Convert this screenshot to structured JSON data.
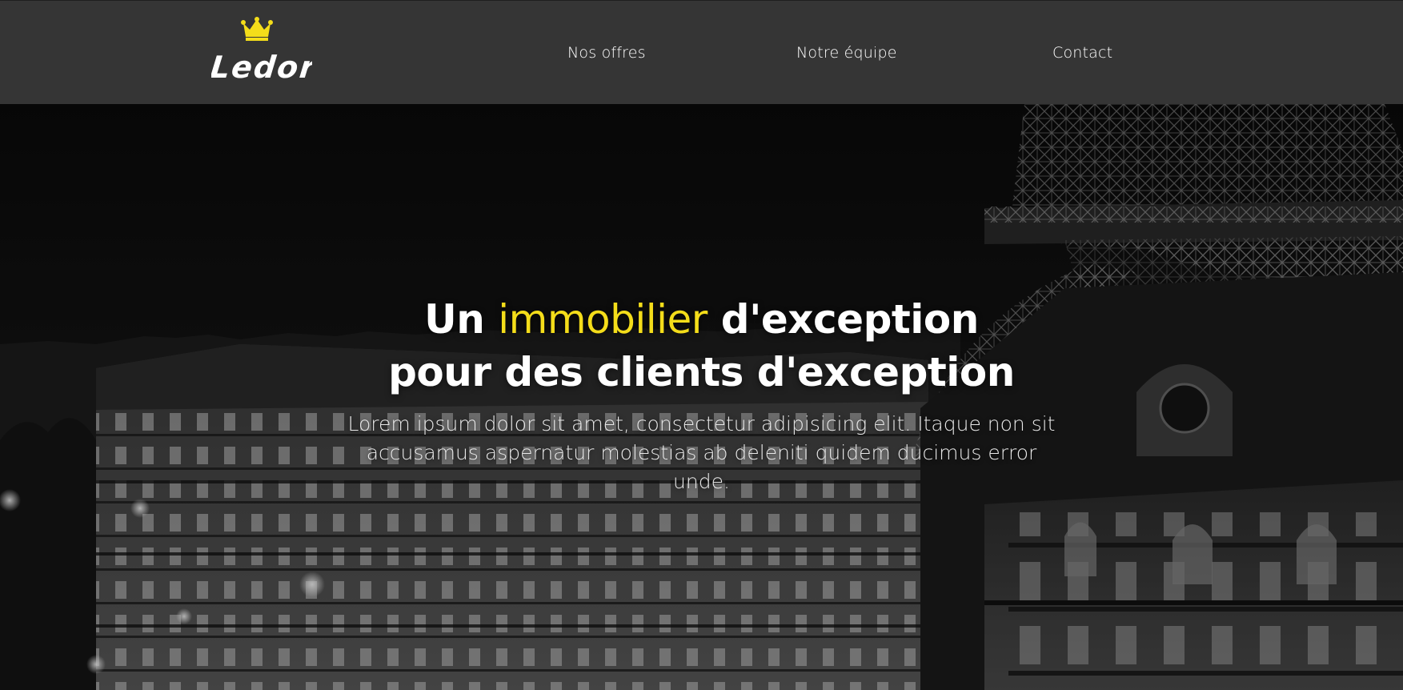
{
  "header": {
    "logo_text": "Ledor",
    "nav": [
      {
        "label": "Nos offres"
      },
      {
        "label": "Notre équipe"
      },
      {
        "label": "Contact"
      }
    ]
  },
  "hero": {
    "title_part1": "Un ",
    "title_accent": "immobilier",
    "title_part2": " d'exception",
    "title_line2": "pour des clients d'exception",
    "subtitle": "Lorem ipsum dolor sit amet, consectetur adipisicing elit. Itaque non sit accusamus aspernatur molestias ab deleniti quidem ducimus error unde."
  },
  "colors": {
    "header_bg": "#353535",
    "accent": "#f4dd1a",
    "text": "#ffffff"
  },
  "icons": {
    "logo": "crown-icon"
  }
}
